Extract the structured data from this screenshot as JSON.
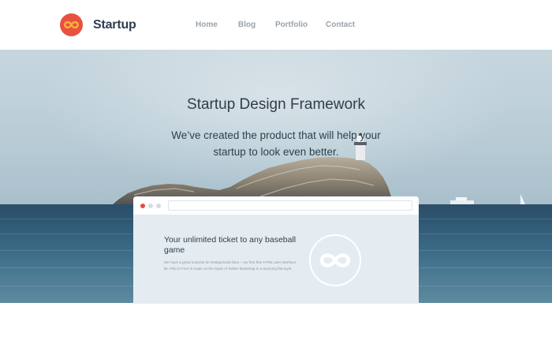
{
  "header": {
    "brand": "Startup",
    "nav": [
      {
        "label": "Home"
      },
      {
        "label": "Blog"
      },
      {
        "label": "Portfolio"
      },
      {
        "label": "Contact"
      }
    ]
  },
  "hero": {
    "title": "Startup Design Framework",
    "subtitle": "We’ve created the product that will help your startup to look even better."
  },
  "browser_mockup": {
    "window_dots": [
      "#e74c3c",
      "#d5dbe0",
      "#d5dbe0"
    ],
    "card": {
      "title": "Your unlimited ticket to any baseball game",
      "text": "We have a great surprise for Designmodo fans – our first free HTML user interface kit. Flat UI Free is made on the basis of Twitter Bootstrap in a stunning flat-style."
    }
  },
  "colors": {
    "accent": "#e8513f",
    "logo_symbol": "#f5a623",
    "heading": "#2c3e50",
    "nav_text": "#9aa3ab",
    "card_bg": "#e5ecf1"
  },
  "icons": {
    "logo": "infinity-icon",
    "card_logo": "infinity-icon"
  }
}
